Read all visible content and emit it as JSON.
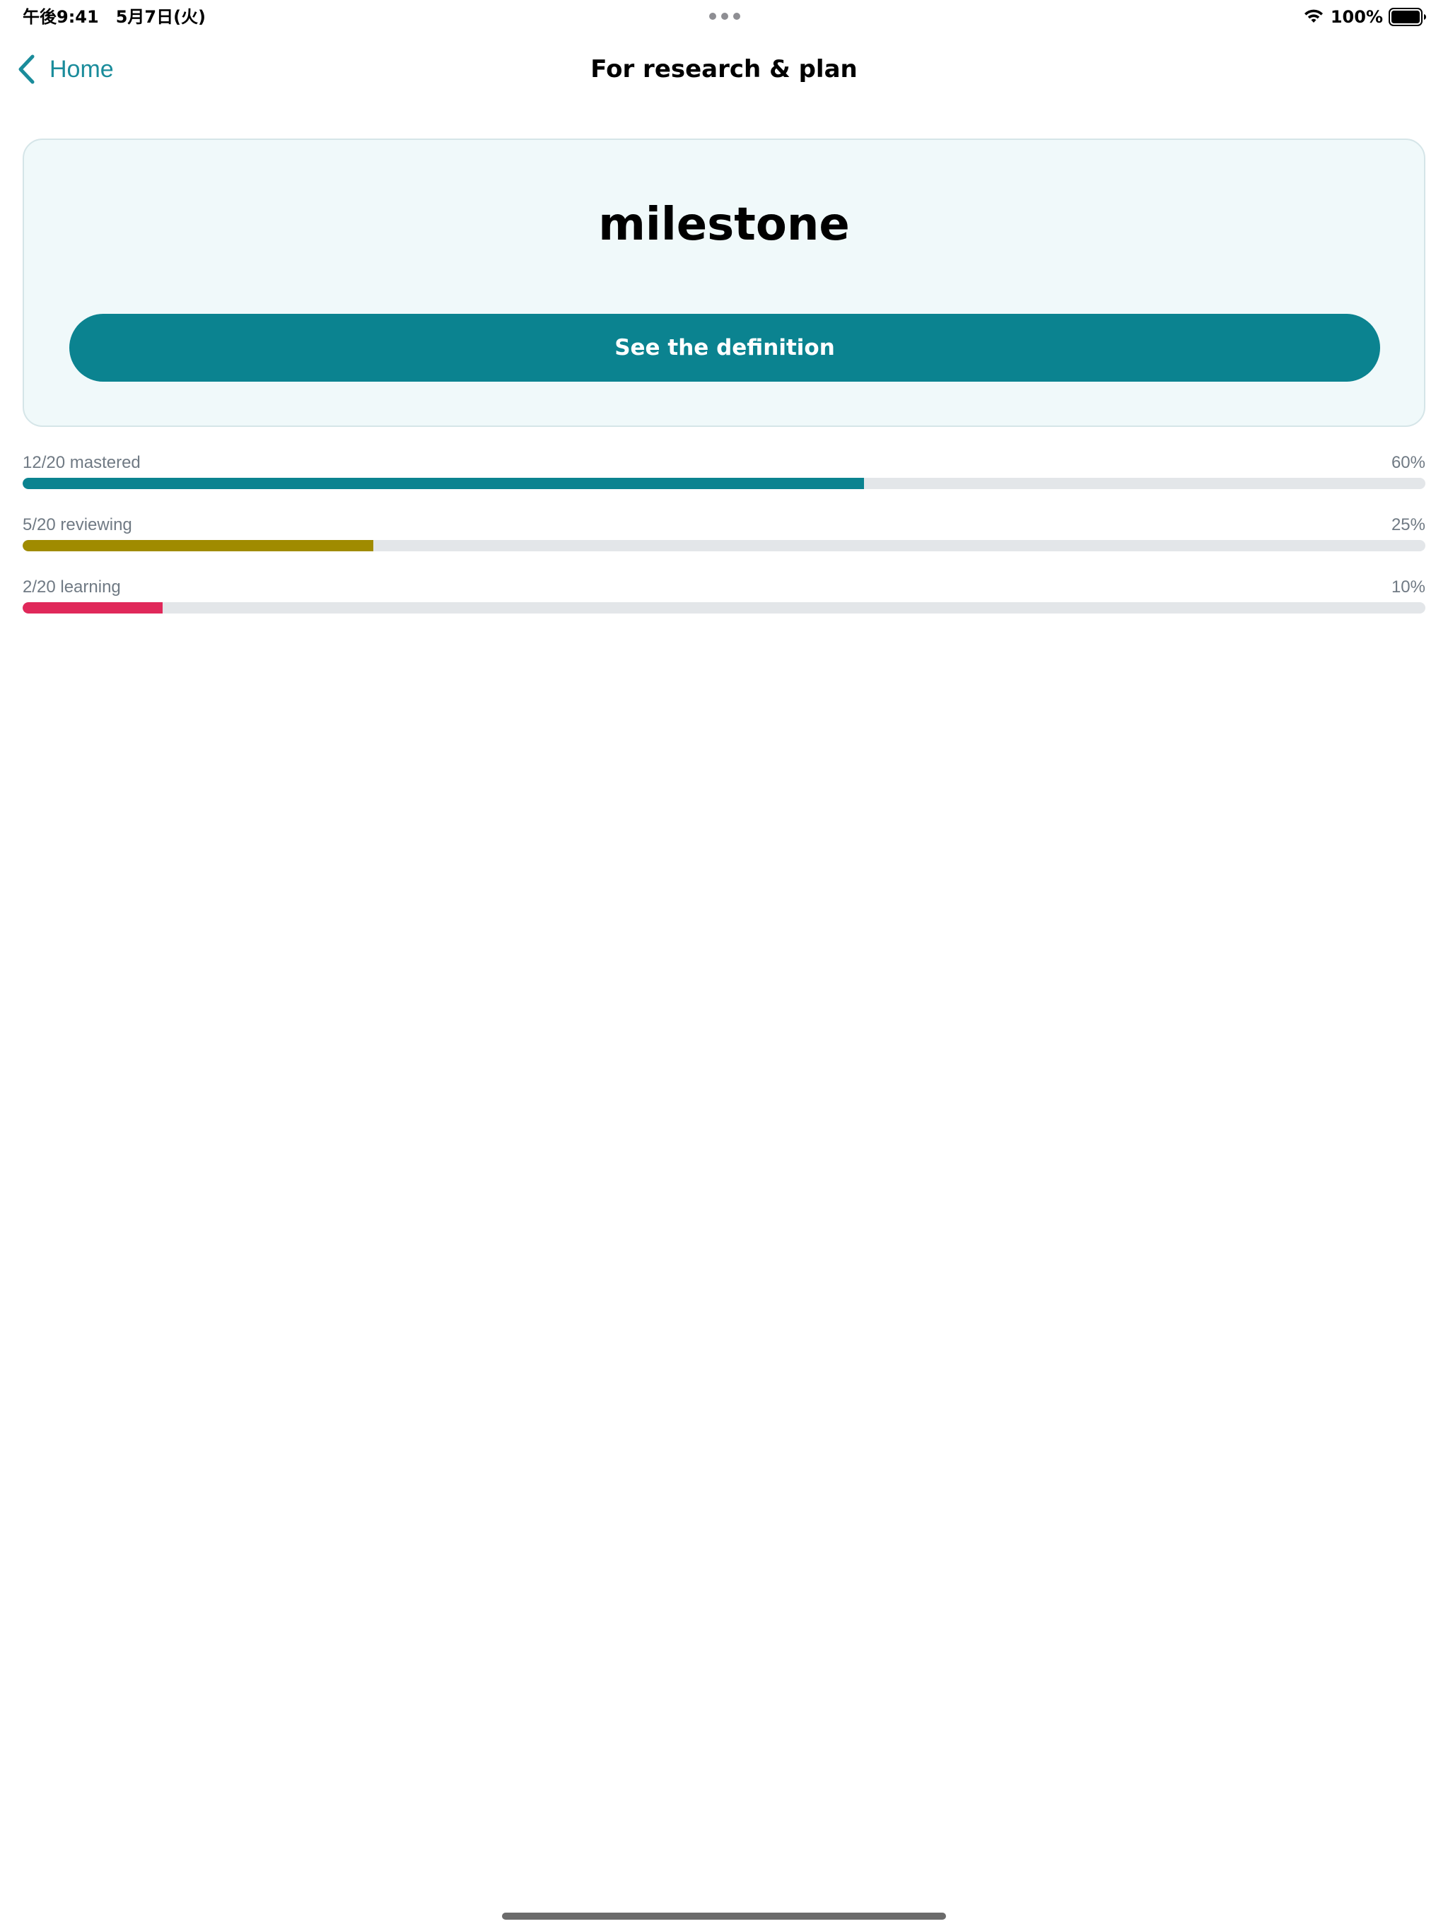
{
  "status_bar": {
    "time": "午後9:41　5月7日(火)",
    "battery": "100%",
    "icons": [
      "wifi-icon",
      "battery-icon",
      "multitasking-dots-icon"
    ]
  },
  "nav": {
    "back_label": "Home",
    "title": "For research & plan",
    "icons": [
      "chevron-left-icon"
    ]
  },
  "card": {
    "word": "milestone",
    "button_label": "See the definition"
  },
  "progress": [
    {
      "label": "12/20 mastered",
      "percent_text": "60%",
      "value": 0.6,
      "color": "#0b8390"
    },
    {
      "label": "5/20 reviewing",
      "percent_text": "25%",
      "value": 0.25,
      "color": "#a08b00"
    },
    {
      "label": "2/20 learning",
      "percent_text": "10%",
      "value": 0.1,
      "color": "#e0285a"
    }
  ],
  "colors": {
    "accent": "#0b8390",
    "back_link": "#1a8c9b",
    "card_background": "#f0f9fa"
  }
}
